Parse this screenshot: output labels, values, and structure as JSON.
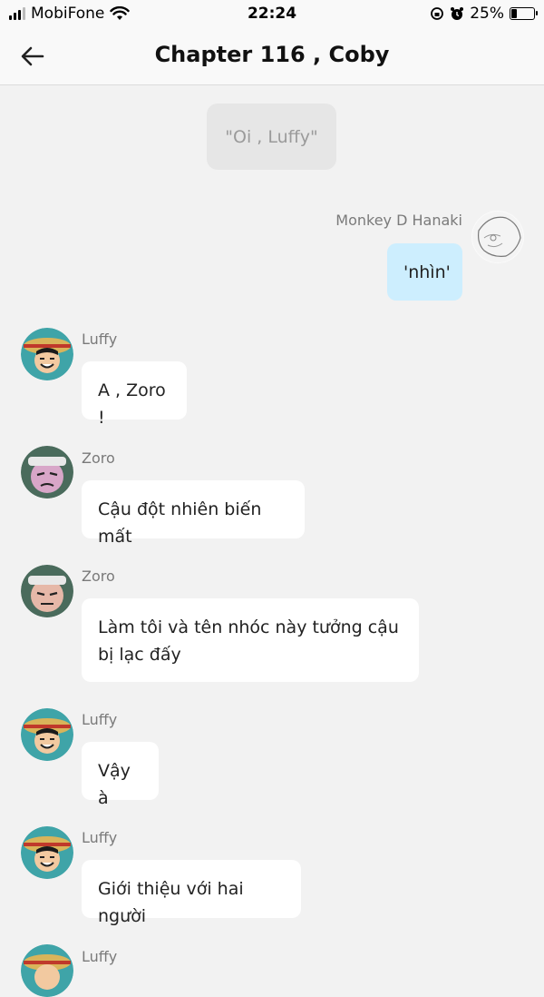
{
  "status": {
    "carrier": "MobiFone",
    "time": "22:24",
    "battery": "25%",
    "battery_level": 0.25
  },
  "header": {
    "title": "Chapter 116 , Coby"
  },
  "narration": "\"Oi , Luffy\"",
  "messages": [
    {
      "sender": "Monkey D Hanaki",
      "text": "'nhìn'",
      "mine": true
    },
    {
      "sender": "Luffy",
      "text": "A , Zoro !"
    },
    {
      "sender": "Zoro",
      "text": "Cậu đột nhiên biến mất"
    },
    {
      "sender": "Zoro",
      "text": "Làm tôi và tên nhóc này tưởng cậu bị lạc đấy"
    },
    {
      "sender": "Luffy",
      "text": "Vậy à"
    },
    {
      "sender": "Luffy",
      "text": "Giới thiệu với hai người"
    },
    {
      "sender": "Luffy",
      "text": ""
    }
  ],
  "colors": {
    "background": "#f2f2f2",
    "my_bubble": "#cdeefe",
    "other_bubble": "#ffffff",
    "narration_bg": "#e6e6e6"
  }
}
